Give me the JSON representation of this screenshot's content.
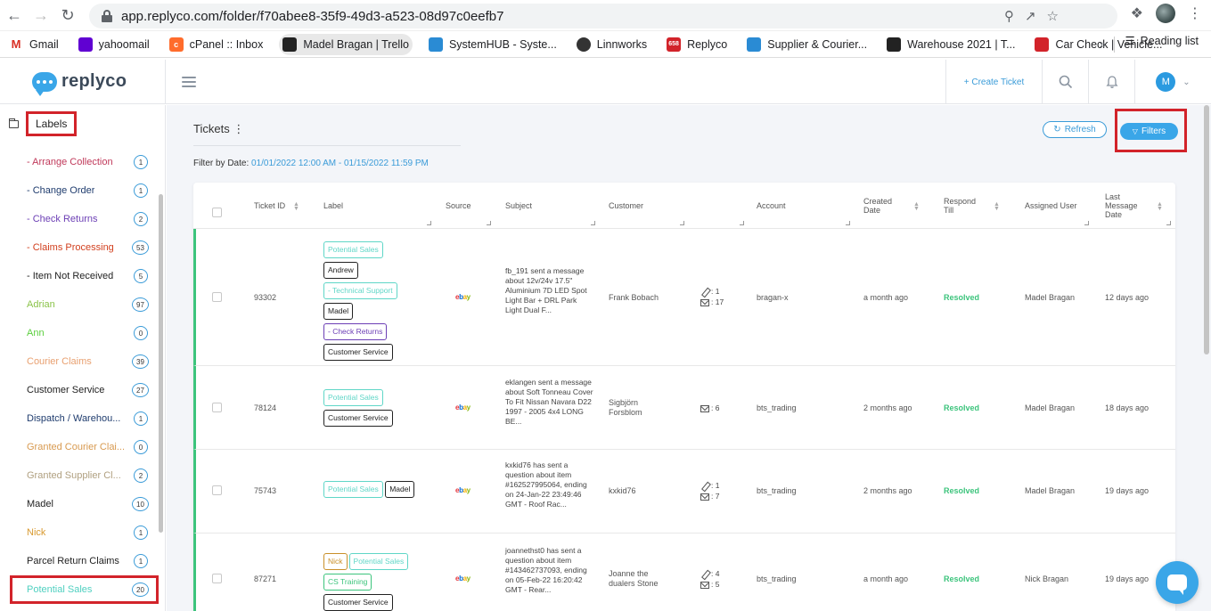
{
  "browser": {
    "url": "app.replyco.com/folder/f70abee8-35f9-49d3-a523-08d97c0eefb7",
    "bookmarks": [
      {
        "label": "Gmail",
        "icon": "gmail-icon",
        "color": "#d93025"
      },
      {
        "label": "yahoomail",
        "icon": "yahoo-icon",
        "color": "#6001d2"
      },
      {
        "label": "cPanel :: Inbox",
        "icon": "cpanel-icon",
        "color": "#ff6c2c"
      },
      {
        "label": "Madel Bragan | Trello",
        "icon": "trello-icon",
        "color": "#222222"
      },
      {
        "label": "SystemHUB - Syste...",
        "icon": "systemhub-icon",
        "color": "#2a8bd4"
      },
      {
        "label": "Linnworks",
        "icon": "linnworks-icon",
        "color": "#333333"
      },
      {
        "label": "Replyco",
        "icon": "replyco-icon",
        "color": "#d2232a"
      },
      {
        "label": "Supplier & Courier...",
        "icon": "sheet-icon",
        "color": "#2a8bd4"
      },
      {
        "label": "Warehouse 2021 | T...",
        "icon": "trello-icon",
        "color": "#222222"
      },
      {
        "label": "Car Check | Vehicle...",
        "icon": "carcheck-icon",
        "color": "#d2232a"
      }
    ],
    "more": "»",
    "reading_list": "Reading list"
  },
  "header": {
    "logo": "replyco",
    "create_ticket": "+ Create Ticket",
    "user_initial": "M"
  },
  "sidebar": {
    "title": "Labels",
    "items": [
      {
        "label": "- Arrange Collection",
        "count": "1",
        "color": "#c0395a"
      },
      {
        "label": "- Change Order",
        "count": "1",
        "color": "#1f3c6e"
      },
      {
        "label": "- Check Returns",
        "count": "2",
        "color": "#6c3fb5"
      },
      {
        "label": "- Claims Processing",
        "count": "53",
        "color": "#d2401f"
      },
      {
        "label": "- Item Not Received",
        "count": "5",
        "color": "#222222"
      },
      {
        "label": "Adrian",
        "count": "97",
        "color": "#8bc34a"
      },
      {
        "label": "Ann",
        "count": "0",
        "color": "#5ccf3f"
      },
      {
        "label": "Courier Claims",
        "count": "39",
        "color": "#e8a070"
      },
      {
        "label": "Customer Service",
        "count": "27",
        "color": "#222222"
      },
      {
        "label": "Dispatch / Warehou...",
        "count": "1",
        "color": "#1f3c6e"
      },
      {
        "label": "Granted Courier Clai...",
        "count": "0",
        "color": "#d89a50"
      },
      {
        "label": "Granted Supplier Cl...",
        "count": "2",
        "color": "#b0a080"
      },
      {
        "label": "Madel",
        "count": "10",
        "color": "#222222"
      },
      {
        "label": "Nick",
        "count": "1",
        "color": "#d89a30"
      },
      {
        "label": "Parcel Return Claims",
        "count": "1",
        "color": "#222222"
      },
      {
        "label": "Potential Sales",
        "count": "20",
        "color": "#4fd0c0"
      }
    ]
  },
  "main": {
    "title": "Tickets",
    "filter_label": "Filter by Date:",
    "filter_value": "01/01/2022 12:00 AM - 01/15/2022 11:59 PM",
    "refresh": "Refresh",
    "filters": "Filters",
    "columns": {
      "ticket_id": "Ticket ID",
      "label": "Label",
      "source": "Source",
      "subject": "Subject",
      "customer": "Customer",
      "account": "Account",
      "created": "Created Date",
      "respond": "Respond Till",
      "assigned": "Assigned User",
      "last": "Last Message Date"
    },
    "rows": [
      {
        "id": "93302",
        "subject": "fb_191 sent a message about 12v/24v 17.5\" Aluminium 7D LED Spot Light Bar + DRL Park Light Dual F...",
        "customer": "Frank Bobach",
        "notes": ": 1",
        "messages": ": 17",
        "account": "bragan-x",
        "created": "a month ago",
        "respond": "Resolved",
        "assigned": "Madel Bragan",
        "last": "12 days ago",
        "tags": [
          "Potential Sales",
          "Andrew",
          "- Technical Support",
          "Madel",
          "- Check Returns",
          "Customer Service"
        ]
      },
      {
        "id": "78124",
        "subject": "eklangen sent a message about Soft Tonneau Cover To Fit Nissan Navara D22 1997 - 2005 4x4 LONG BE...",
        "customer": "Sigbjörn Forsblom",
        "notes": "",
        "messages": ": 6",
        "account": "bts_trading",
        "created": "2 months ago",
        "respond": "Resolved",
        "assigned": "Madel Bragan",
        "last": "18 days ago",
        "tags": [
          "Potential Sales",
          "Customer Service"
        ]
      },
      {
        "id": "75743",
        "subject": "kxkid76 has sent a question about item #162527995064, ending on 24-Jan-22 23:49:46 GMT - Roof Rac...",
        "customer": "kxkid76",
        "notes": ": 1",
        "messages": ": 7",
        "account": "bts_trading",
        "created": "2 months ago",
        "respond": "Resolved",
        "assigned": "Madel Bragan",
        "last": "19 days ago",
        "tags": [
          "Potential Sales",
          "Madel"
        ]
      },
      {
        "id": "87271",
        "subject": "joannethst0 has sent a question about item #143462737093, ending on 05-Feb-22 16:20:42 GMT - Rear...",
        "customer": "Joanne the dualers Stone",
        "notes": ": 4",
        "messages": ": 5",
        "account": "bts_trading",
        "created": "a month ago",
        "respond": "Resolved",
        "assigned": "Nick Bragan",
        "last": "19 days ago",
        "tags": [
          "Nick",
          "Potential Sales",
          "CS Training",
          "Customer Service"
        ]
      }
    ]
  },
  "ebay": {
    "e": "e",
    "b": "b",
    "a": "a",
    "y": "y"
  }
}
